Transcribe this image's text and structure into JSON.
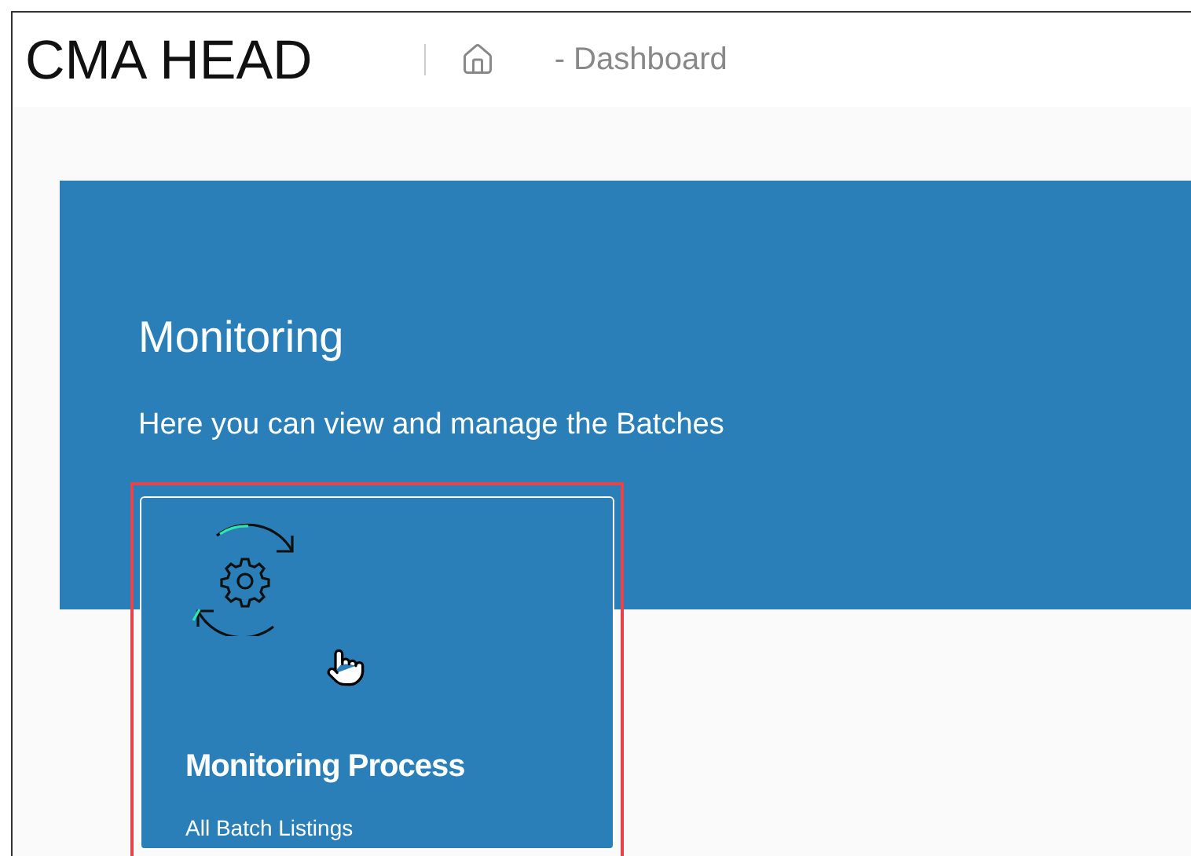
{
  "header": {
    "title": "CMA HEAD",
    "breadcrumb": "- Dashboard"
  },
  "banner": {
    "title": "Monitoring",
    "subtitle": "Here you can view and manage the Batches"
  },
  "cards": [
    {
      "title": "Monitoring Process",
      "subtitle": "All Batch Listings",
      "highlighted": true
    }
  ]
}
